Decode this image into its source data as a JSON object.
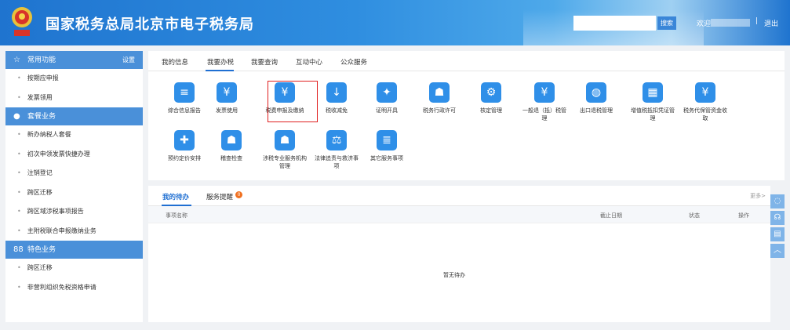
{
  "header": {
    "title": "国家税务总局北京市电子税务局",
    "search_label": "搜索",
    "welcome": "欢迎",
    "separator": "|",
    "logout": "退出"
  },
  "sidebar": {
    "common": {
      "title": "常用功能",
      "action": "设置",
      "items": [
        "按期应申报",
        "发票领用"
      ]
    },
    "package": {
      "title": "套餐业务",
      "items": [
        "新办纳税人套餐",
        "初次申领发票快捷办理",
        "注销登记",
        "跨区迁移",
        "跨区域涉税事项报告",
        "主附税联合申报缴纳业务"
      ]
    },
    "special": {
      "title": "特色业务",
      "items": [
        "跨区迁移",
        "非营利组织免税资格申请"
      ]
    }
  },
  "tabs": [
    "我的信息",
    "我要办税",
    "我要查询",
    "互动中心",
    "公众服务"
  ],
  "active_tab": "我要办税",
  "services_row1": [
    {
      "label": "综合信息报告",
      "icon": "document-icon"
    },
    {
      "label": "发票使用",
      "icon": "invoice-icon"
    },
    {
      "label": "税费申报及缴纳",
      "icon": "tax-declaration-icon"
    },
    {
      "label": "税收减免",
      "icon": "tax-reduction-icon"
    },
    {
      "label": "证明开具",
      "icon": "certificate-icon"
    },
    {
      "label": "税务行政许可",
      "icon": "license-icon"
    },
    {
      "label": "核定管理",
      "icon": "user-gear-icon"
    },
    {
      "label": "一般退（抵）税管理",
      "icon": "refund-icon"
    },
    {
      "label": "出口退税管理",
      "icon": "export-globe-icon"
    },
    {
      "label": "增值税抵扣凭证管理",
      "icon": "vat-voucher-icon"
    },
    {
      "label": "税务代保管资金收取",
      "icon": "money-bag-icon"
    }
  ],
  "services_row2": [
    {
      "label": "预约定价安排",
      "icon": "pricing-compass-icon"
    },
    {
      "label": "稽查检查",
      "icon": "inspector-icon"
    },
    {
      "label": "涉税专业服务机构管理",
      "icon": "agency-icon"
    },
    {
      "label": "法律追责与救济事项",
      "icon": "gavel-icon"
    },
    {
      "label": "其它服务事项",
      "icon": "list-icon"
    }
  ],
  "bottom": {
    "tabs": [
      "我的待办",
      "服务提醒"
    ],
    "badge": "0",
    "more": "更多>",
    "columns": [
      "事项名称",
      "截止日期",
      "状态",
      "操作"
    ],
    "empty": "暂无待办"
  },
  "colors": {
    "header": "#2f8ee0",
    "accent": "#1f6fd2",
    "sidebar_head": "#4a90d9",
    "highlight": "#e02020"
  }
}
